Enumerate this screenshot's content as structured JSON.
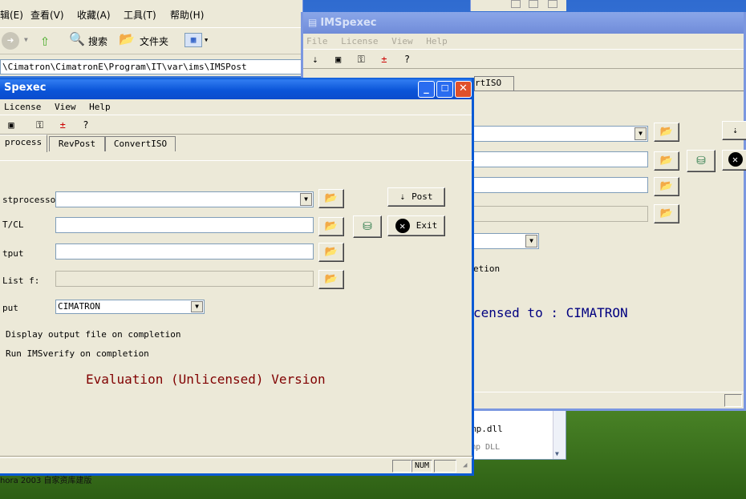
{
  "explorer": {
    "menu": [
      "辑(E)",
      "查看(V)",
      "收藏(A)",
      "工具(T)",
      "帮助(H)"
    ],
    "search_label": "搜索",
    "folders_label": "文件夹",
    "address": "\\Cimatron\\CimatronE\\Program\\IT\\var\\ims\\IMSPost"
  },
  "desktop": {
    "caption": "hora 2003    自家资库建版"
  },
  "behind": {
    "files": [
      "mp.dll",
      "mp DLL"
    ]
  },
  "back": {
    "title": "IMSpexec",
    "menu": [
      "File",
      "License",
      "View",
      "Help"
    ],
    "tab_partial": "rtISO",
    "completion_partial": "etion",
    "licensed_text": "censed to : CIMATRON"
  },
  "front": {
    "title": "Spexec",
    "menu": [
      "License",
      "View",
      "Help"
    ],
    "tabs": [
      "process",
      "RevPost",
      "ConvertISO"
    ],
    "labels": {
      "postprocessor": "stprocesso",
      "ntcl": "T/CL",
      "output": "tput",
      "listfile": " List f:",
      "output_type": "put"
    },
    "values": {
      "postprocessor": "",
      "ntcl": "",
      "output": "",
      "listfile": "",
      "output_type": "CIMATRON"
    },
    "buttons": {
      "post": "Post",
      "exit": "Exit"
    },
    "checks": [
      "Display output file on completion",
      "Run IMSverify on completion"
    ],
    "eval_text": "Evaluation (Unlicensed) Version",
    "status_num": "NUM"
  }
}
